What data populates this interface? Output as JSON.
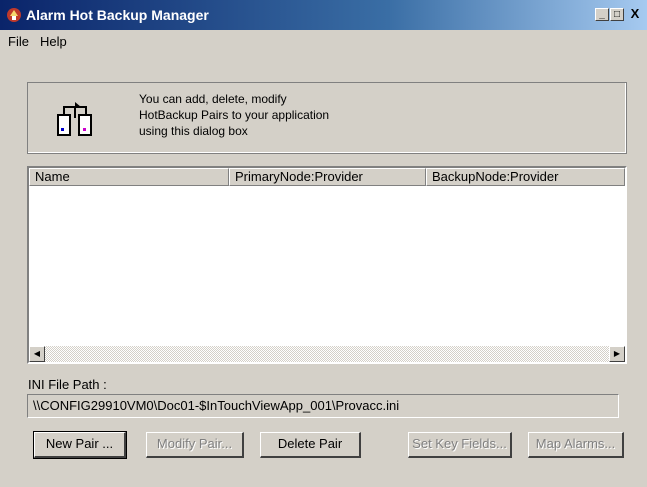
{
  "window": {
    "title": "Alarm Hot Backup Manager",
    "controls": {
      "minimize": "_",
      "maximize": "□",
      "close": "X"
    }
  },
  "menu": {
    "file": "File",
    "help": "Help"
  },
  "info": {
    "line1": "You can add, delete, modify",
    "line2": "HotBackup Pairs to your application",
    "line3": "using this dialog box"
  },
  "list": {
    "columns": [
      "Name",
      "PrimaryNode:Provider",
      "BackupNode:Provider"
    ],
    "rows": []
  },
  "ini": {
    "label": "INI File Path :",
    "value": "\\\\CONFIG29910VM0\\Doc01-$InTouchViewApp_001\\Provacc.ini"
  },
  "buttons": {
    "new_pair": "New Pair ...",
    "modify_pair": "Modify Pair...",
    "delete_pair": "Delete Pair",
    "set_key_fields": "Set Key Fields...",
    "map_alarms": "Map Alarms..."
  },
  "colors": {
    "titlebar_start": "#0a246a",
    "titlebar_end": "#a6caf0",
    "face": "#d4d0c8"
  }
}
